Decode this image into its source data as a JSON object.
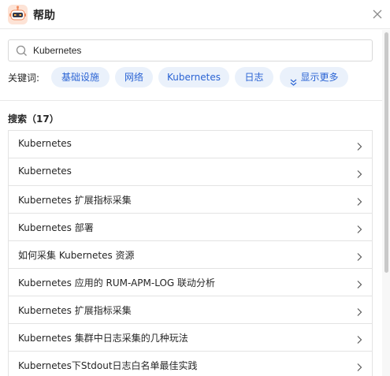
{
  "header": {
    "title": "帮助",
    "close_icon": "close-icon",
    "app_icon": "robot-mascot-icon"
  },
  "search": {
    "value": "Kubernetes",
    "placeholder": "",
    "icon": "search-icon"
  },
  "keywords": {
    "label": "关键词:",
    "chips": [
      "基础设施",
      "网络",
      "Kubernetes",
      "日志"
    ],
    "more_label": "显示更多",
    "more_icon": "double-chevron-down-icon"
  },
  "results": {
    "title": "搜索（17）",
    "items": [
      "Kubernetes",
      "Kubernetes",
      "Kubernetes 扩展指标采集",
      "Kubernetes 部署",
      "如何采集 Kubernetes 资源",
      "Kubernetes 应用的 RUM-APM-LOG 联动分析",
      "Kubernetes 扩展指标采集",
      "Kubernetes 集群中日志采集的几种玩法",
      "Kubernetes下Stdout日志白名单最佳实践"
    ]
  },
  "colors": {
    "accent": "#2b64d4",
    "chip_bg": "#eaf1fb",
    "border": "#e3e3e3"
  }
}
